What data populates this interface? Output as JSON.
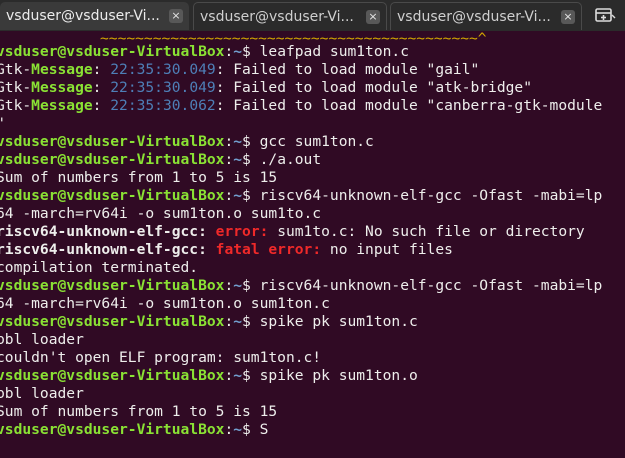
{
  "tabs": [
    {
      "label": "vsduser@vsduser-Vi...",
      "active": true
    },
    {
      "label": "vsduser@vsduser-Vi...",
      "active": false
    },
    {
      "label": "vsduser@vsduser-Vi...",
      "active": false
    }
  ],
  "tab_close_glyph": "×",
  "new_tab_icon": "terminal-plus-icon",
  "terminal": {
    "squiggle": "~~~~~~~~~~~~~~~~~~~~~~~~~~~~~~~~~~~~~~~~~~~^",
    "lines": [
      {
        "user": "vsduser@vsduser-VirtualBox",
        "path": "~",
        "command": "leafpad sum1ton.c"
      },
      {
        "kind": "gtk",
        "label": "Gtk-Message",
        "time": "22:35:30.049",
        "text": ": Failed to load module \"gail\""
      },
      {
        "kind": "gtk",
        "label": "Gtk-Message",
        "time": "22:35:30.049",
        "text": ": Failed to load module \"atk-bridge\""
      },
      {
        "kind": "gtk",
        "label": "Gtk-Message",
        "time": "22:35:30.062",
        "text": ": Failed to load module \"canberra-gtk-module"
      },
      {
        "text": "\""
      },
      {
        "user": "vsduser@vsduser-VirtualBox",
        "path": "~",
        "command": "gcc sum1ton.c"
      },
      {
        "user": "vsduser@vsduser-VirtualBox",
        "path": "~",
        "command": "./a.out"
      },
      {
        "text": "Sum of numbers from 1 to 5 is 15"
      },
      {
        "user": "vsduser@vsduser-VirtualBox",
        "path": "~",
        "command": "riscv64-unknown-elf-gcc -Ofast -mabi=lp"
      },
      {
        "text": "64 -march=rv64i -o sum1ton.o sum1to.c"
      },
      {
        "kind": "err",
        "prog": "riscv64-unknown-elf-gcc:",
        "errword": "error:",
        "text": "sum1to.c: No such file or directory"
      },
      {
        "kind": "err",
        "prog": "riscv64-unknown-elf-gcc:",
        "errword": "fatal error:",
        "text": "no input files"
      },
      {
        "text": "compilation terminated."
      },
      {
        "user": "vsduser@vsduser-VirtualBox",
        "path": "~",
        "command": "riscv64-unknown-elf-gcc -Ofast -mabi=lp"
      },
      {
        "text": "64 -march=rv64i -o sum1ton.o sum1ton.c"
      },
      {
        "user": "vsduser@vsduser-VirtualBox",
        "path": "~",
        "command": "spike pk sum1ton.c"
      },
      {
        "text": "bbl loader"
      },
      {
        "text": "couldn't open ELF program: sum1ton.c!"
      },
      {
        "user": "vsduser@vsduser-VirtualBox",
        "path": "~",
        "command": "spike pk sum1ton.o"
      },
      {
        "text": "bbl loader"
      },
      {
        "text": "Sum of numbers from 1 to 5 is 15"
      },
      {
        "user": "vsduser@vsduser-VirtualBox",
        "path": "~",
        "command": "S"
      }
    ]
  },
  "colors": {
    "background": "#300a24",
    "prompt_user": "#8ae234",
    "prompt_path": "#729fcf",
    "error": "#ef2929",
    "timestamp": "#4e7fb7"
  }
}
